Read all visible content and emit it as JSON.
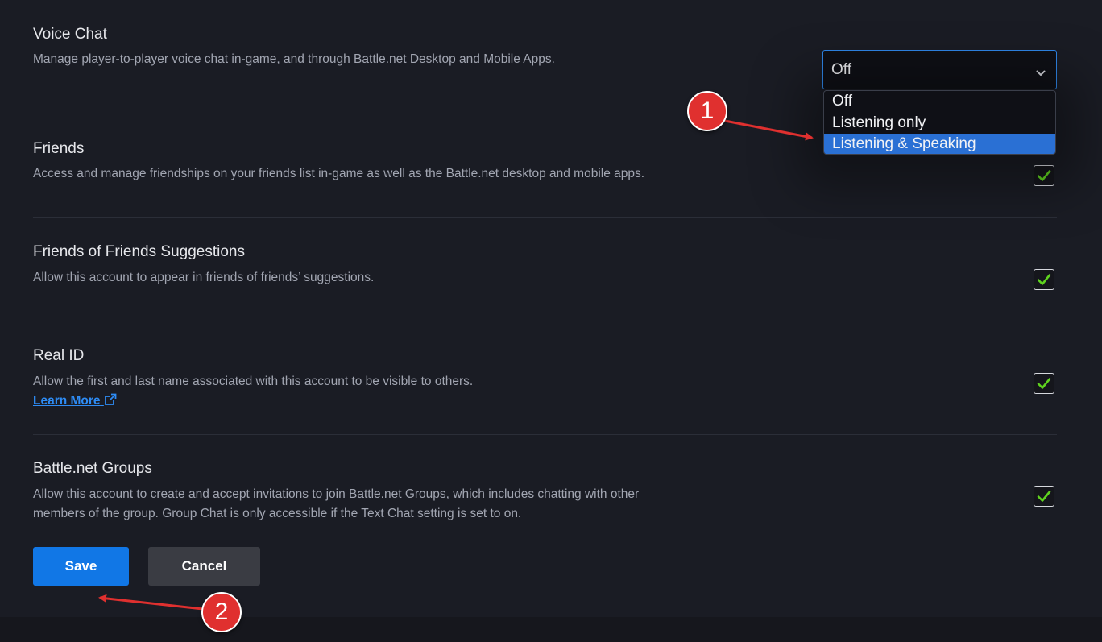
{
  "voice_chat": {
    "title": "Voice Chat",
    "description": "Manage player-to-player voice chat in-game, and through Battle.net Desktop and Mobile Apps.",
    "selected": "Off",
    "options": [
      "Off",
      "Listening only",
      "Listening & Speaking"
    ],
    "highlighted_option": "Listening & Speaking"
  },
  "friends": {
    "title": "Friends",
    "description": "Access and manage friendships on your friends list in-game as well as the Battle.net desktop and mobile apps.",
    "checked": true
  },
  "fof": {
    "title": "Friends of Friends Suggestions",
    "description": "Allow this account to appear in friends of friends’ suggestions.",
    "checked": true
  },
  "real_id": {
    "title": "Real ID",
    "description": "Allow the first and last name associated with this account to be visible to others.",
    "learn_more": "Learn More",
    "checked": true
  },
  "groups": {
    "title": "Battle.net Groups",
    "description_line1": "Allow this account to create and accept invitations to join Battle.net Groups, which includes chatting with other",
    "description_line2": "members of the group. Group Chat is only accessible if the Text Chat setting is set to on.",
    "checked": true
  },
  "actions": {
    "save": "Save",
    "cancel": "Cancel"
  },
  "annotations": {
    "badge1": "1",
    "badge2": "2"
  },
  "colors": {
    "accent": "#1177e6",
    "link": "#2e8cf5",
    "check": "#5fd31f",
    "annotation": "#e0302f",
    "highlight": "#2a70d4"
  }
}
